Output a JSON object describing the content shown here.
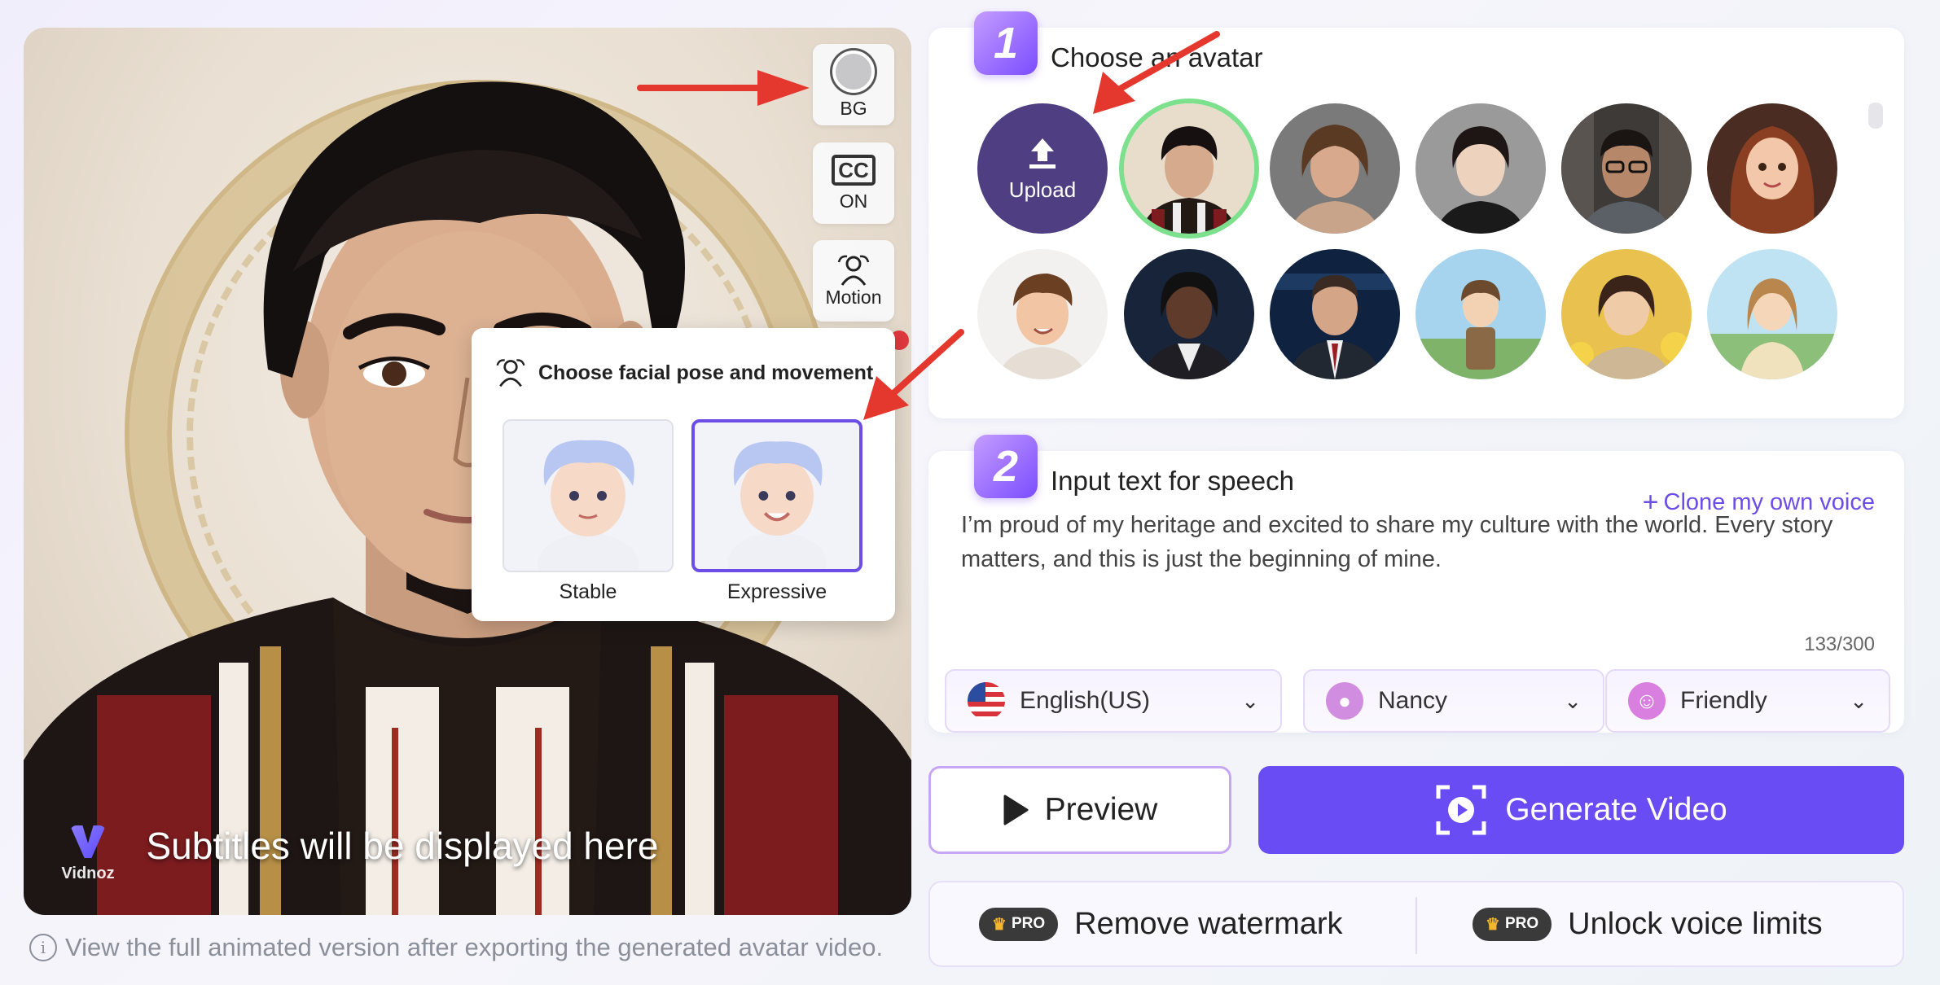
{
  "preview": {
    "subtitle_placeholder": "Subtitles will be displayed here",
    "brand_name": "Vidnoz",
    "side_buttons": {
      "bg_label": "BG",
      "cc_icon_text": "CC",
      "cc_label": "ON",
      "motion_label": "Motion"
    },
    "pose_popup": {
      "title": "Choose facial pose and movement",
      "options": [
        {
          "label": "Stable",
          "selected": false
        },
        {
          "label": "Expressive",
          "selected": true
        }
      ]
    },
    "note": "View the full animated version after exporting the generated avatar video."
  },
  "step1": {
    "number": "1",
    "title": "Choose an avatar",
    "upload_label": "Upload",
    "avatars": [
      {
        "name": "avatar-young-man-traditional",
        "selected": true
      },
      {
        "name": "avatar-woman-curly-hair"
      },
      {
        "name": "avatar-woman-black-shirt"
      },
      {
        "name": "avatar-man-glasses-office"
      },
      {
        "name": "avatar-cartoon-woman-red-hair"
      },
      {
        "name": "avatar-cartoon-man-brown-hair"
      },
      {
        "name": "avatar-news-anchor-woman"
      },
      {
        "name": "avatar-news-anchor-man"
      },
      {
        "name": "avatar-anime-boy-field"
      },
      {
        "name": "avatar-anime-girl-sunflowers"
      },
      {
        "name": "avatar-anime-girl-meadow"
      }
    ]
  },
  "step2": {
    "number": "2",
    "title": "Input text for speech",
    "clone_link": "Clone my own voice",
    "text": "I’m proud of my heritage and excited to share my culture with the world. Every story matters, and this is just the beginning of mine.",
    "counter": "133/300",
    "language": "English(US)",
    "voice": "Nancy",
    "emotion": "Friendly"
  },
  "actions": {
    "preview_label": "Preview",
    "generate_label": "Generate Video"
  },
  "pro": {
    "badge": "PRO",
    "remove_watermark": "Remove watermark",
    "unlock_voice": "Unlock voice limits"
  },
  "colors": {
    "accent": "#6a4cf4",
    "upload_bg": "#4f3f82",
    "selected_ring": "#7ce08c",
    "annotation_arrow": "#e4382e"
  }
}
